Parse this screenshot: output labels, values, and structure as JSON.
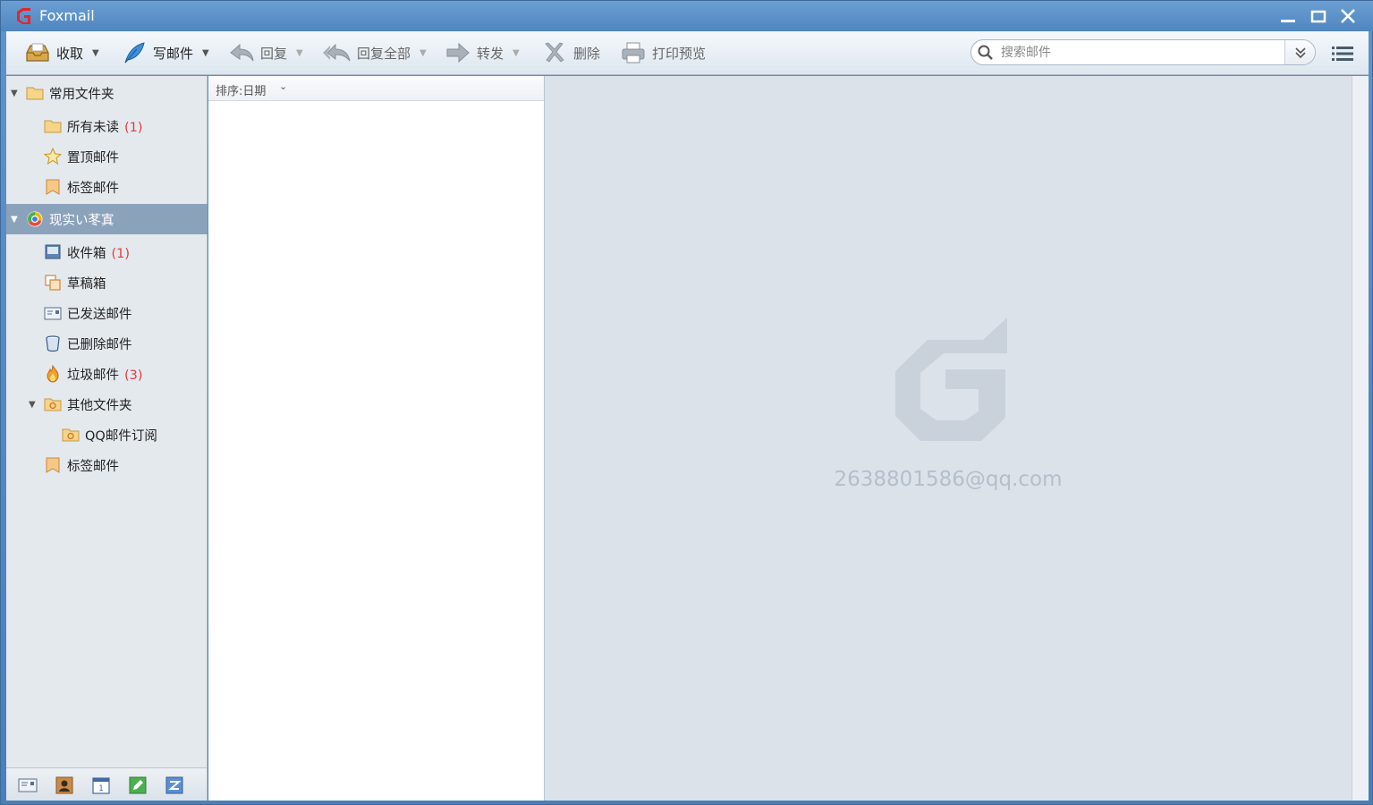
{
  "window": {
    "title": "Foxmail"
  },
  "toolbar": {
    "receive_label": "收取",
    "compose_label": "写邮件",
    "reply_label": "回复",
    "reply_all_label": "回复全部",
    "forward_label": "转发",
    "delete_label": "删除",
    "print_preview_label": "打印预览"
  },
  "search": {
    "placeholder": "搜索邮件"
  },
  "sidebar": {
    "common_folders": {
      "label": "常用文件夹",
      "items": [
        {
          "label": "所有未读",
          "count": "(1)"
        },
        {
          "label": "置顶邮件",
          "count": ""
        },
        {
          "label": "标签邮件",
          "count": ""
        }
      ]
    },
    "account": {
      "label": "现实い苳寘",
      "items": [
        {
          "label": "收件箱",
          "count": "(1)"
        },
        {
          "label": "草稿箱",
          "count": ""
        },
        {
          "label": "已发送邮件",
          "count": ""
        },
        {
          "label": "已删除邮件",
          "count": ""
        },
        {
          "label": "垃圾邮件",
          "count": "(3)"
        },
        {
          "label": "其他文件夹",
          "count": ""
        },
        {
          "label": "QQ邮件订阅",
          "count": ""
        },
        {
          "label": "标签邮件",
          "count": ""
        }
      ]
    }
  },
  "maillist": {
    "sort_label": "排序:日期"
  },
  "reading": {
    "account_email": "2638801586@qq.com"
  },
  "colors": {
    "accent": "#4a7fb8",
    "selected": "#8ba2bb",
    "count": "#e53c3c"
  }
}
